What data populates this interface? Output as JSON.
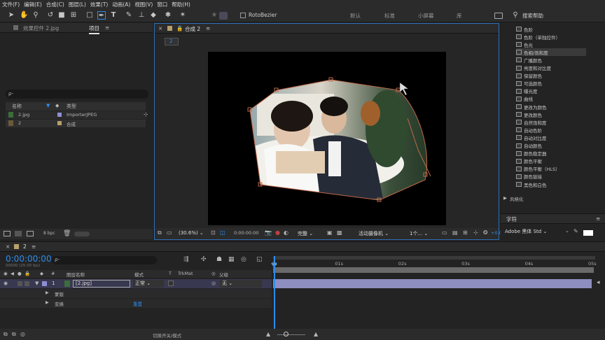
{
  "menu": [
    "文件(F)",
    "编辑(E)",
    "合成(C)",
    "图层(L)",
    "效果(T)",
    "动画(A)",
    "视图(V)",
    "窗口",
    "帮助(H)"
  ],
  "toolbar": {
    "rotobezier_label": "RotoBezier",
    "workspaces": [
      "默认",
      "标准",
      "小屏幕",
      "库"
    ],
    "search_placeholder": "搜索帮助"
  },
  "left_panel": {
    "tab_effects": "效果控件 2.jpg",
    "tab_project": "项目",
    "search_placeholder": "ρ-",
    "col_name": "名称",
    "col_type": "类型",
    "items": [
      {
        "name": "2.jpg",
        "type": "ImporterJPEG",
        "color": "#8e8ed6"
      },
      {
        "name": "2",
        "type": "合成",
        "color": "#b8a06a"
      }
    ],
    "bpc": "8 bpc"
  },
  "comp_panel": {
    "tab": "合成 2",
    "crumb": "2",
    "zoom": "(30.6%)",
    "timecode": "0:00:00:00",
    "quality": "完整",
    "camera": "活动摄像机",
    "views": "1个...",
    "offset": "+0.0"
  },
  "effects_list": {
    "items": [
      "色阶",
      "色阶（单独控件）",
      "色光",
      "色相/饱和度",
      "广播颜色",
      "亮度和对比度",
      "保留颜色",
      "可选颜色",
      "曝光度",
      "曲线",
      "更改为颜色",
      "更改颜色",
      "自然饱和度",
      "自动色阶",
      "自动对比度",
      "自动颜色",
      "颜色稳定器",
      "颜色平衡",
      "颜色平衡（HLS）",
      "颜色链接",
      "黑色和白色"
    ],
    "selected_index": 3,
    "group": "风格化"
  },
  "char_panel": {
    "tab": "字符",
    "font": "Adobe 黑体 Std"
  },
  "timeline": {
    "tab": "2",
    "timecode": "0:00:00:00",
    "timecode_sub": "00000 (25.00 fps)",
    "search_placeholder": "ρ-",
    "headers": {
      "num": "#",
      "name": "图层名称",
      "mode": "模式",
      "t": "T",
      "trkmat": "TrkMat",
      "parent": "父级"
    },
    "layer": {
      "num": "1",
      "name": "[2.jpg]",
      "mode": "正常",
      "parent": "无"
    },
    "sub_rows": [
      {
        "label": "蒙版",
        "value": ""
      },
      {
        "label": "变换",
        "value": "重置"
      }
    ],
    "ticks": [
      "0s",
      "01s",
      "02s",
      "03s",
      "04s",
      "05s"
    ],
    "footer": "切换开关/模式"
  }
}
